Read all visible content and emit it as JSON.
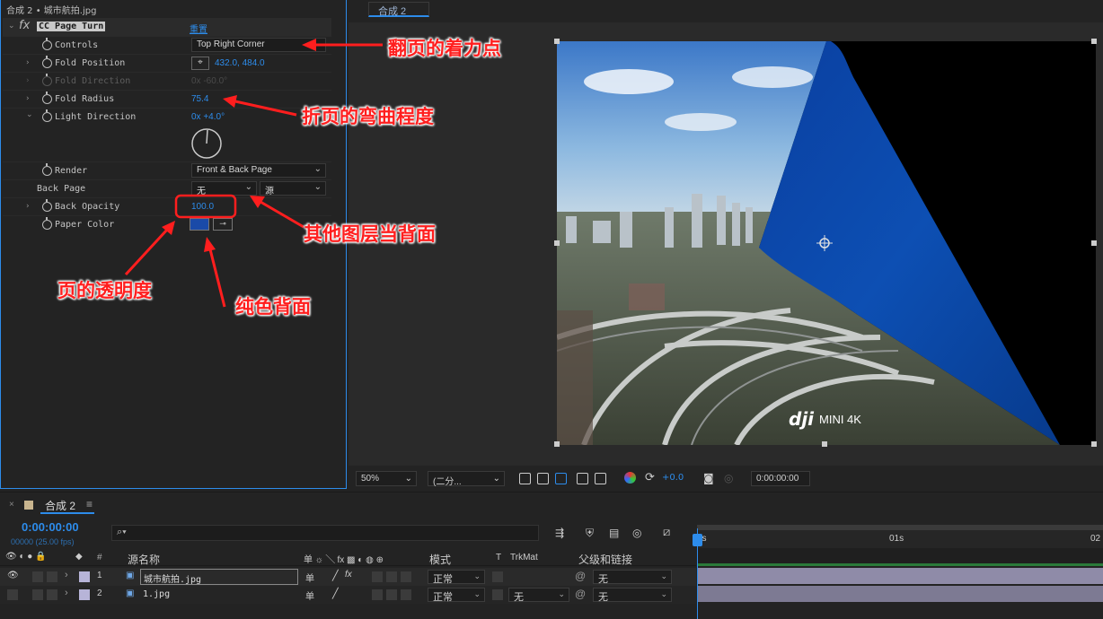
{
  "effect_panel": {
    "title": "合成 2 • 城市航拍.jpg",
    "effect_name": "CC Page Turn",
    "reset_label": "重置",
    "controls_label": "Controls",
    "controls_value": "Top Right Corner",
    "fold_position_label": "Fold Position",
    "fold_position_value": "432.0, 484.0",
    "fold_direction_label": "Fold Direction",
    "fold_direction_value": "0x -60.0°",
    "fold_radius_label": "Fold Radius",
    "fold_radius_value": "75.4",
    "light_direction_label": "Light Direction",
    "light_direction_value": "0x +4.0°",
    "render_label": "Render",
    "render_value": "Front & Back Page",
    "back_page_label": "Back Page",
    "back_page_value1": "无",
    "back_page_value2": "源",
    "back_opacity_label": "Back Opacity",
    "back_opacity_value": "100.0",
    "paper_color_label": "Paper Color",
    "paper_color": "#1a4aa8"
  },
  "viewer": {
    "tab": "合成 2",
    "zoom": "50%",
    "resolution": "(二分...",
    "exposure": "+0.0",
    "timecode": "0:00:00:00",
    "watermark_brand": "dji",
    "watermark_model": "MINI 4K",
    "back_page_color": "#0c4ca8"
  },
  "annotations": {
    "a1": "翻页的着力点",
    "a2": "折页的弯曲程度",
    "a3": "其他图层当背面",
    "a4": "页的透明度",
    "a5": "纯色背面"
  },
  "timeline": {
    "comp_tab": "合成 2",
    "timecode": "0:00:00:00",
    "frames": "00000 (25.00 fps)",
    "search_placeholder": "",
    "col_num": "#",
    "col_source": "源名称",
    "col_mode": "模式",
    "col_t": "T",
    "col_trkmat": "TrkMat",
    "col_parent": "父级和链接",
    "ruler": [
      "0s",
      "01s",
      "02"
    ],
    "layers": [
      {
        "num": "1",
        "name": "城市航拍.jpg",
        "mode": "正常",
        "trkmat": "",
        "parent": "无"
      },
      {
        "num": "2",
        "name": "1.jpg",
        "mode": "正常",
        "trkmat": "无",
        "parent": "无"
      }
    ]
  }
}
